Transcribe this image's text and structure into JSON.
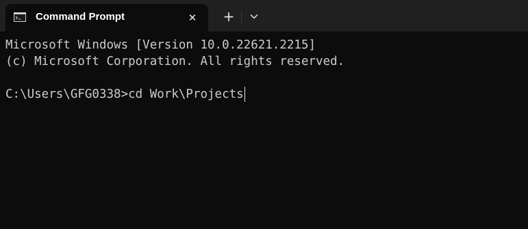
{
  "tab": {
    "title": "Command Prompt",
    "icon": "cmd-icon",
    "close_icon": "close-icon"
  },
  "tabbar": {
    "new_tab_icon": "plus-icon",
    "dropdown_icon": "chevron-down-icon"
  },
  "console": {
    "line1": "Microsoft Windows [Version 10.0.22621.2215]",
    "line2": "(c) Microsoft Corporation. All rights reserved.",
    "prompt": "C:\\Users\\GFG0338>",
    "command": "cd Work\\Projects"
  },
  "colors": {
    "background": "#0c0c0c",
    "tabbar": "#202020",
    "text": "#cccccc"
  }
}
